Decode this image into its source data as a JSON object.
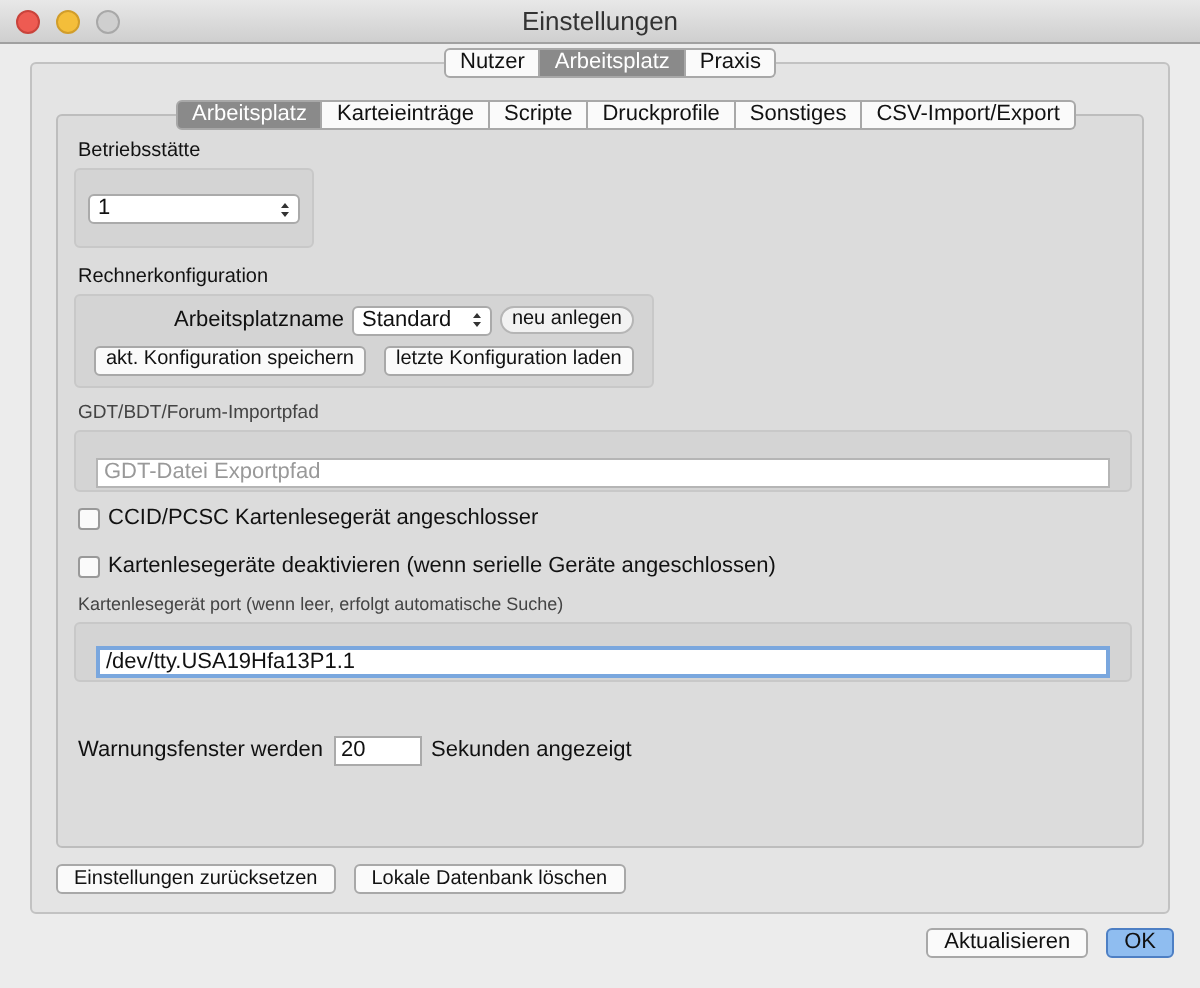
{
  "window": {
    "title": "Einstellungen"
  },
  "top_tabs": [
    {
      "label": "Nutzer",
      "selected": false
    },
    {
      "label": "Arbeitsplatz",
      "selected": true
    },
    {
      "label": "Praxis",
      "selected": false
    }
  ],
  "sub_tabs": [
    {
      "label": "Arbeitsplatz",
      "selected": true
    },
    {
      "label": "Karteieinträge",
      "selected": false
    },
    {
      "label": "Scripte",
      "selected": false
    },
    {
      "label": "Druckprofile",
      "selected": false
    },
    {
      "label": "Sonstiges",
      "selected": false
    },
    {
      "label": "CSV-Import/Export",
      "selected": false
    }
  ],
  "betriebsstaette": {
    "label": "Betriebsstätte",
    "value": "1"
  },
  "rechnerkonfiguration": {
    "label": "Rechnerkonfiguration",
    "name_label": "Arbeitsplatzname",
    "name_value": "Standard",
    "new_button": "neu anlegen",
    "save_button": "akt. Konfiguration speichern",
    "load_button": "letzte Konfiguration laden"
  },
  "import_path": {
    "label": "GDT/BDT/Forum-Importpfad",
    "placeholder": "GDT-Datei Exportpfad"
  },
  "checkboxes": [
    {
      "label": "CCID/PCSC Kartenlesegerät angeschlosser",
      "checked": false
    },
    {
      "label": "Kartenlesegeräte deaktivieren (wenn serielle Geräte angeschlossen)",
      "checked": false
    }
  ],
  "port": {
    "label": "Kartenlesegerät port (wenn leer, erfolgt automatische Suche)",
    "value": "/dev/tty.USA19Hfa13P1.1",
    "focused": true
  },
  "warning": {
    "before": "Warnungsfenster werden",
    "value": "20",
    "after": "Sekunden angezeigt"
  },
  "panel_buttons": [
    "Einstellungen zurücksetzen",
    "Lokale Datenbank löschen"
  ],
  "dialog_buttons": [
    {
      "label": "Aktualisieren",
      "default": false
    },
    {
      "label": "OK",
      "default": true
    }
  ]
}
